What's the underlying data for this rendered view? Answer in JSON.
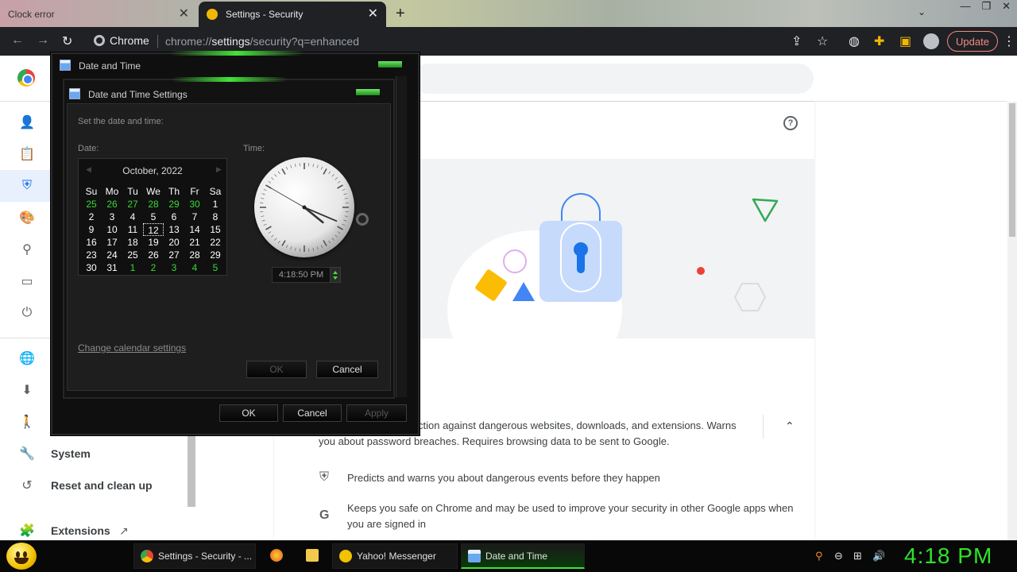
{
  "browser": {
    "tabs": [
      {
        "title": "Clock error",
        "active": false
      },
      {
        "title": "Settings - Security",
        "active": true
      }
    ],
    "new_tab": "+",
    "omnibox_chip": "Chrome",
    "url_prefix": "chrome://",
    "url_bold": "settings",
    "url_suffix": "/security?q=enhanced",
    "update_label": "Update"
  },
  "sidebar": {
    "items": [
      {
        "icon": "person-icon",
        "label": ""
      },
      {
        "icon": "clipboard-icon",
        "label": ""
      },
      {
        "icon": "shield-icon",
        "label": "",
        "selected": true
      },
      {
        "icon": "palette-icon",
        "label": ""
      },
      {
        "icon": "search-icon",
        "label": ""
      },
      {
        "icon": "browser-icon",
        "label": ""
      },
      {
        "icon": "power-icon",
        "label": ""
      },
      {
        "icon": "globe-icon",
        "label": ""
      },
      {
        "icon": "download-icon",
        "label": ""
      },
      {
        "icon": "accessibility-icon",
        "label": ""
      },
      {
        "icon": "wrench-icon",
        "label": "System"
      },
      {
        "icon": "reset-icon",
        "label": "Reset and clean up"
      },
      {
        "icon": "puzzle-icon",
        "label": "Extensions"
      }
    ]
  },
  "main": {
    "feature_partial": "ction against dangerous websites, downloads, and extensions. Warns",
    "feature_line2": "you about password breaches. Requires browsing data to be sent to Google.",
    "features": [
      {
        "icon": "shield-icon",
        "text": "Predicts and warns you about dangerous events before they happen"
      },
      {
        "icon": "google-icon",
        "text_line1": "Keeps you safe on Chrome and may be used to improve your security in other Google apps when",
        "text_line2": "you are signed in"
      }
    ]
  },
  "outer_dialog": {
    "title": "Date and Time",
    "ok": "OK",
    "cancel": "Cancel",
    "apply": "Apply"
  },
  "inner_dialog": {
    "title": "Date and Time Settings",
    "prompt": "Set the date and time:",
    "date_label": "Date:",
    "time_label": "Time:",
    "calendar": {
      "month_year": "October, 2022",
      "days_of_week": [
        "Su",
        "Mo",
        "Tu",
        "We",
        "Th",
        "Fr",
        "Sa"
      ],
      "weeks": [
        [
          "25",
          "26",
          "27",
          "28",
          "29",
          "30",
          "1"
        ],
        [
          "2",
          "3",
          "4",
          "5",
          "6",
          "7",
          "8"
        ],
        [
          "9",
          "10",
          "11",
          "12",
          "13",
          "14",
          "15"
        ],
        [
          "16",
          "17",
          "18",
          "19",
          "20",
          "21",
          "22"
        ],
        [
          "23",
          "24",
          "25",
          "26",
          "27",
          "28",
          "29"
        ],
        [
          "30",
          "31",
          "1",
          "2",
          "3",
          "4",
          "5"
        ]
      ],
      "selected": "12"
    },
    "clock": {
      "hour": 4,
      "minute": 18,
      "second": 50
    },
    "time_value": "4:18:50 PM",
    "change_calendar_link": "Change calendar settings",
    "ok": "OK",
    "cancel": "Cancel"
  },
  "taskbar": {
    "items": [
      {
        "label": "Settings - Security - ...",
        "active": false
      },
      {
        "label": "Yahoo! Messenger",
        "active": false
      },
      {
        "label": "Date and Time",
        "active": true
      }
    ],
    "clock": "4:18 PM"
  },
  "colors": {
    "accent_green": "#2fe32a",
    "chrome_blue": "#1a73e8",
    "update_red": "#f28b82"
  }
}
